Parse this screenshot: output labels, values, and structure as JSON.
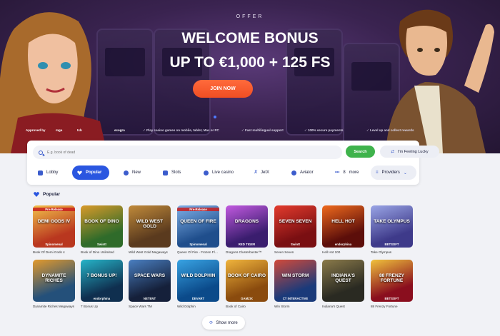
{
  "hero": {
    "offer_label": "OFFER",
    "title_line1": "WELCOME BONUS",
    "title_line2": "UP TO €1,000 + 125 FS",
    "cta_label": "JOIN NOW",
    "approved_by_label": "Approved by",
    "trust_logos": [
      "mga",
      "tcb",
      "ecogra"
    ],
    "trust_items": [
      "Play casino games on mobile, tablet, Mac or PC",
      "Fast multilingual support",
      "100% secure payments",
      "Level up and collect rewards"
    ]
  },
  "search": {
    "placeholder": "E.g. book of dead",
    "search_button": "Search",
    "lucky_button": "I'm Feeling Lucky"
  },
  "tabs": [
    {
      "label": "Lobby",
      "icon": "house-icon"
    },
    {
      "label": "Popular",
      "icon": "heart-icon",
      "active": true
    },
    {
      "label": "New",
      "icon": "plus-icon"
    },
    {
      "label": "Slots",
      "icon": "slots-icon"
    },
    {
      "label": "Live casino",
      "icon": "live-icon"
    },
    {
      "label": "JetX",
      "icon": "jetx-icon"
    },
    {
      "label": "Aviator",
      "icon": "aviator-icon"
    },
    {
      "label": "more",
      "count": "8",
      "icon": "dots-icon"
    },
    {
      "label": "Providers",
      "icon": "filter-icon"
    }
  ],
  "section": {
    "title": "Popular"
  },
  "games": [
    {
      "name": "Book Of Demi Gods 4",
      "thumb_title": "DEMI GODS IV",
      "ribbon": "Pre-Release",
      "provider": "Spinomenal",
      "colors": [
        "#b9371f",
        "#f2c14a"
      ]
    },
    {
      "name": "Book of Dino Unlimited",
      "thumb_title": "BOOK OF DINO",
      "ribbon": "",
      "provider": "Swintt",
      "colors": [
        "#2f6b2a",
        "#d99a2a"
      ]
    },
    {
      "name": "Wild West Gold Megaways",
      "thumb_title": "WILD WEST GOLD",
      "ribbon": "",
      "provider": "",
      "colors": [
        "#5a3a1e",
        "#c08a3a"
      ]
    },
    {
      "name": "Queen Of Fire - Frozen Flames",
      "thumb_title": "QUEEN OF FIRE",
      "ribbon": "Pre-Release",
      "provider": "Spinomenal",
      "colors": [
        "#1f4e8c",
        "#7fb0e8"
      ]
    },
    {
      "name": "Dragons Clusterbuster™",
      "thumb_title": "DRAGONS",
      "ribbon": "",
      "provider": "RED TIGER",
      "colors": [
        "#3a1d6e",
        "#c25ae0"
      ]
    },
    {
      "name": "Seven Seven",
      "thumb_title": "SEVEN SEVEN",
      "ribbon": "",
      "provider": "Swintt",
      "colors": [
        "#7a0f12",
        "#e33b2d"
      ]
    },
    {
      "name": "Hell Hot 100",
      "thumb_title": "HELL HOT",
      "ribbon": "",
      "provider": "endorphina",
      "colors": [
        "#5c0e0a",
        "#ef6a1d"
      ]
    },
    {
      "name": "Take Olympus",
      "thumb_title": "TAKE OLYMPUS",
      "ribbon": "",
      "provider": "BETSOFT",
      "colors": [
        "#3e3a8a",
        "#9aa5e6"
      ]
    },
    {
      "name": "Dynamite Riches Megaways",
      "thumb_title": "DYNAMITE RICHES",
      "ribbon": "",
      "provider": "",
      "colors": [
        "#24507a",
        "#e39a2c"
      ]
    },
    {
      "name": "7 Bonus Up",
      "thumb_title": "7 BONUS UP!",
      "ribbon": "",
      "provider": "endorphina",
      "colors": [
        "#0f2f4f",
        "#26b4c8"
      ]
    },
    {
      "name": "Space Wars TM",
      "thumb_title": "SPACE WARS",
      "ribbon": "",
      "provider": "NETENT",
      "colors": [
        "#15203a",
        "#4a7fc1"
      ]
    },
    {
      "name": "Wild Dolphin",
      "thumb_title": "WILD DOLPHIN",
      "ribbon": "",
      "provider": "DEVART",
      "colors": [
        "#0b4a8a",
        "#38a3e3"
      ]
    },
    {
      "name": "Book of Cairo",
      "thumb_title": "BOOK OF CAIRO",
      "ribbon": "",
      "provider": "GAMZIX",
      "colors": [
        "#8a4b0e",
        "#f0b43c"
      ]
    },
    {
      "name": "Win Storm",
      "thumb_title": "WIN STORM",
      "ribbon": "",
      "provider": "CT INTERACTIVE",
      "colors": [
        "#1a3a7a",
        "#d24a3a"
      ]
    },
    {
      "name": "Indiana's Quest",
      "thumb_title": "INDIANA'S QUEST",
      "ribbon": "",
      "provider": "",
      "colors": [
        "#2a2a22",
        "#8a7a4a"
      ]
    },
    {
      "name": "88 Frenzy Fortune",
      "thumb_title": "88 FRENZY FORTUNE",
      "ribbon": "",
      "provider": "BETSOFT",
      "colors": [
        "#8a0e1e",
        "#f0c23c"
      ]
    }
  ],
  "show_more": "Show more"
}
